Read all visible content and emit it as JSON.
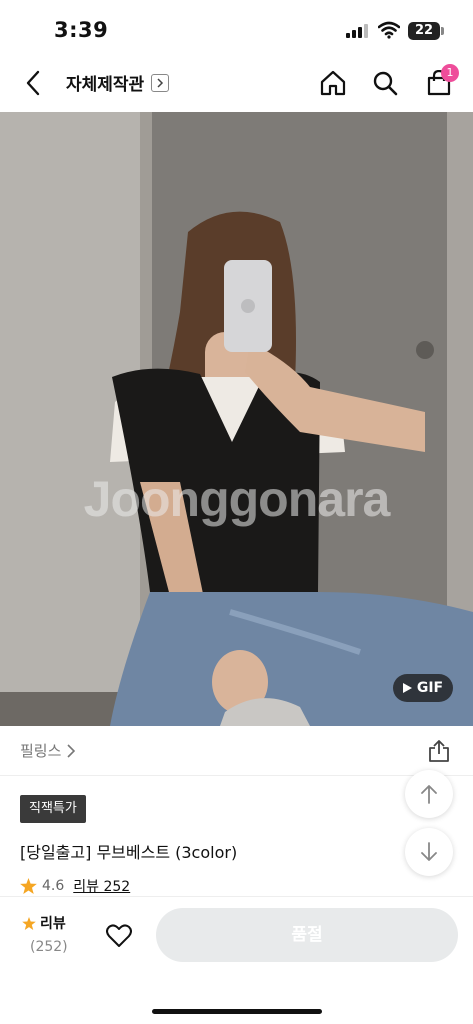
{
  "status_bar": {
    "time": "3:39",
    "battery": "22"
  },
  "header": {
    "title": "자체제작관",
    "cart_count": "1"
  },
  "product": {
    "watermark": "Joonggonara",
    "gif_label": "GIF",
    "brand": "필링스",
    "tag": "직잭특가",
    "title": "[당일출고] 무브베스트 (3color)",
    "rating": "4.6",
    "review_link": "리뷰 252"
  },
  "bottom_bar": {
    "review_label": "리뷰",
    "review_count": "(252)",
    "purchase_button": "품절"
  },
  "colors": {
    "accent_star": "#f5a623",
    "badge": "#ee4d9a",
    "tag_bg": "#3a3a3a",
    "soldout_bg": "#e8eaeb"
  }
}
